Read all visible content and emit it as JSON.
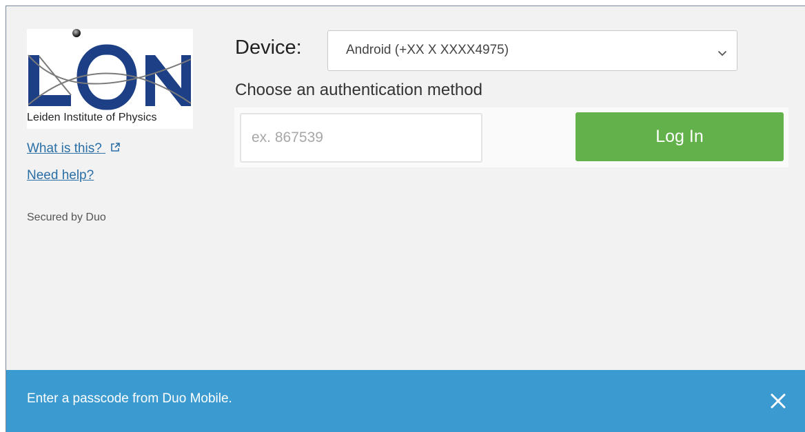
{
  "sidebar": {
    "logo_caption": "Leiden Institute of Physics",
    "what_is_this_label": "What is this?",
    "need_help_label": "Need help?",
    "secured_text": "Secured by Duo"
  },
  "device": {
    "label": "Device:",
    "selected": "Android (+XX X XXXX4975)"
  },
  "auth": {
    "method_label": "Choose an authentication method",
    "passcode_placeholder": "ex. 867539",
    "login_label": "Log In"
  },
  "notice": {
    "message": "Enter a passcode from Duo Mobile."
  },
  "colors": {
    "accent_green": "#63b14a",
    "notice_blue": "#3b9bd1",
    "link_blue": "#2a6ea6",
    "logo_navy": "#1c3f86"
  },
  "icons": {
    "external_link": "external-link-icon",
    "dropdown": "chevron-down-icon",
    "close": "close-icon"
  }
}
